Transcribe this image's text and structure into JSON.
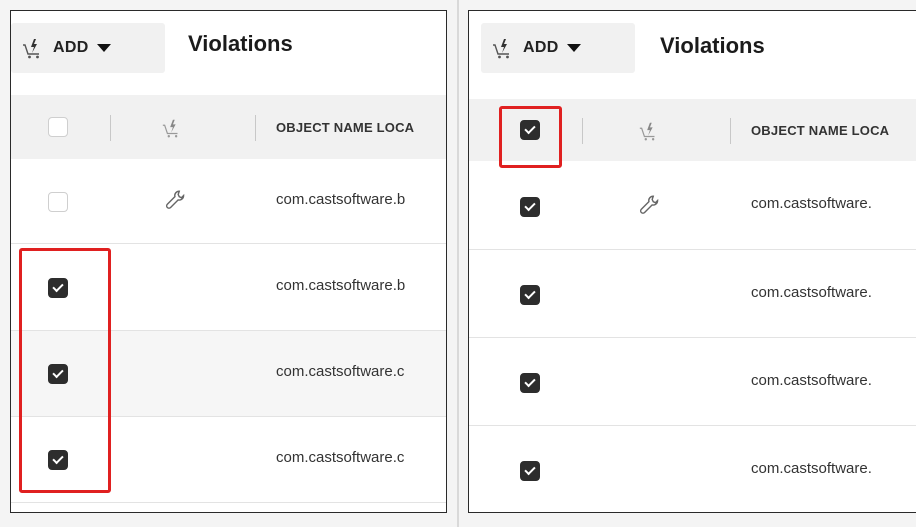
{
  "toolbar": {
    "add_label": "ADD",
    "title": "Violations"
  },
  "table": {
    "column_object_name": "OBJECT NAME LOCA"
  },
  "left_panel": {
    "rows": [
      {
        "text": "com.castsoftware.b",
        "checked": false,
        "has_wrench": true
      },
      {
        "text": "com.castsoftware.b",
        "checked": true,
        "has_wrench": false
      },
      {
        "text": "com.castsoftware.c",
        "checked": true,
        "has_wrench": false
      },
      {
        "text": "com.castsoftware.c",
        "checked": true,
        "has_wrench": false
      }
    ],
    "header_checked": false
  },
  "right_panel": {
    "rows": [
      {
        "text": "com.castsoftware.",
        "checked": true,
        "has_wrench": true
      },
      {
        "text": "com.castsoftware.",
        "checked": true,
        "has_wrench": false
      },
      {
        "text": "com.castsoftware.",
        "checked": true,
        "has_wrench": false
      },
      {
        "text": "com.castsoftware.",
        "checked": true,
        "has_wrench": false
      }
    ],
    "header_checked": true
  },
  "colors": {
    "highlight": "#e02020",
    "checkbox_checked": "#2d2d2d"
  }
}
